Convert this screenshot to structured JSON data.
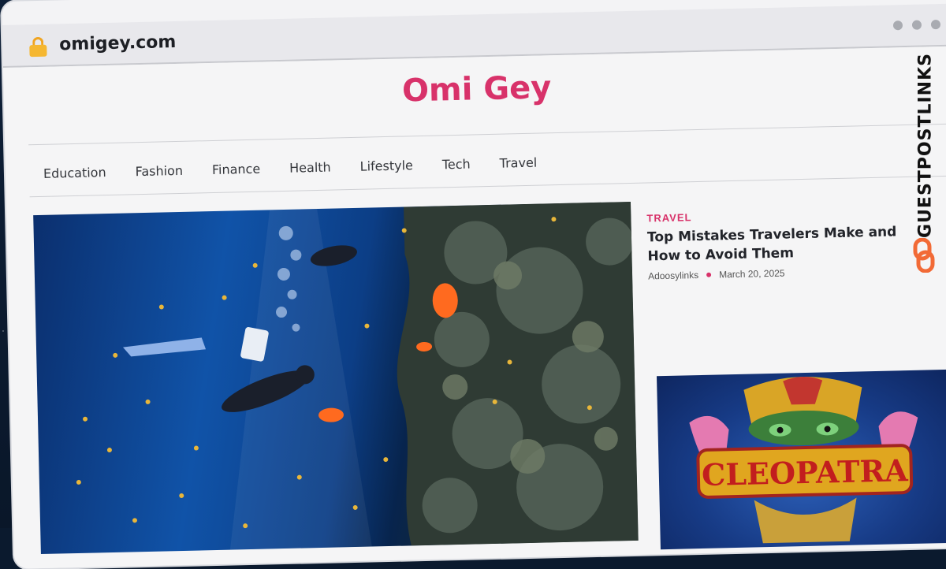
{
  "browser": {
    "url": "omigey.com"
  },
  "site": {
    "title": "Omi Gey",
    "brand_color": "#d8326a"
  },
  "nav": {
    "items": [
      "Education",
      "Fashion",
      "Finance",
      "Health",
      "Lifestyle",
      "Tech",
      "Travel"
    ]
  },
  "featured_side": {
    "category": "TRAVEL",
    "headline": "Top Mistakes Travelers Make and How to Avoid Them",
    "author": "Adoosylinks",
    "date": "March 20, 2025"
  },
  "thumbnail": {
    "logo_text": "CLEOPATRA"
  },
  "watermark": {
    "text": "GUESTPOSTLINKS",
    "accent": "#f26a36"
  },
  "icons": {
    "lock": "lock-icon",
    "window_dots": "window-controls-icon",
    "watermark_logo": "link-icon"
  }
}
